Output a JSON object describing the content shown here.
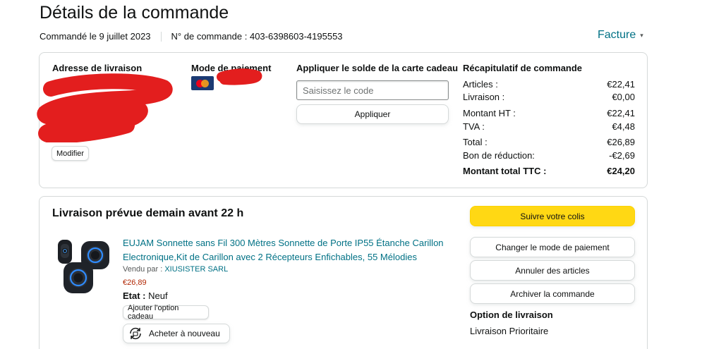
{
  "page_title": "Détails de la commande",
  "order_meta": {
    "ordered_on": "Commandé le 9 juillet 2023",
    "order_number": "N° de commande : 403-6398603-4195553"
  },
  "invoice_label": "Facture",
  "shipping_address": {
    "title": "Adresse de livraison",
    "edit_label": "Modifier"
  },
  "payment": {
    "title": "Mode de paiement",
    "card_brand": "mastercard-icon"
  },
  "gift_card": {
    "title": "Appliquer le solde de la carte cadeau",
    "input_placeholder": "Saisissez le code",
    "input_value": "",
    "apply_label": "Appliquer"
  },
  "summary": {
    "title": "Récapitulatif de commande",
    "rows": [
      {
        "label": "Articles :",
        "value": "€22,41"
      },
      {
        "label": "Livraison :",
        "value": "€0,00"
      },
      {
        "label": "Montant HT :",
        "value": "€22,41"
      },
      {
        "label": "TVA :",
        "value": "€4,48"
      },
      {
        "label": "Total :",
        "value": "€26,89"
      },
      {
        "label": "Bon de réduction:",
        "value": "-€2,69"
      },
      {
        "label": "Montant total TTC :",
        "value": "€24,20"
      }
    ]
  },
  "shipment": {
    "title": "Livraison prévue demain avant 22 h",
    "product": {
      "title": "EUJAM Sonnette sans Fil 300 Mètres Sonnette de Porte IP55 Étanche Carillon Electronique,Kit de Carillon avec 2 Récepteurs Enfichables, 55 Mélodies",
      "sold_by_label": "Vendu par :",
      "seller": "XIUSISTER SARL",
      "price": "€26,89",
      "state_label": "Etat :",
      "state_value": "Neuf",
      "gift_label": "Ajouter l'option cadeau",
      "rebuy_label": "Acheter à nouveau"
    },
    "actions": {
      "track": "Suivre votre colis",
      "change_payment": "Changer le mode de paiement",
      "cancel": "Annuler des articles",
      "archive": "Archiver la commande"
    },
    "shipping_option": {
      "title": "Option de livraison",
      "value": "Livraison Prioritaire"
    }
  },
  "colors": {
    "link": "#007185",
    "price": "#b12704",
    "primary_button": "#ffd814",
    "redaction": "#e31e1e"
  }
}
